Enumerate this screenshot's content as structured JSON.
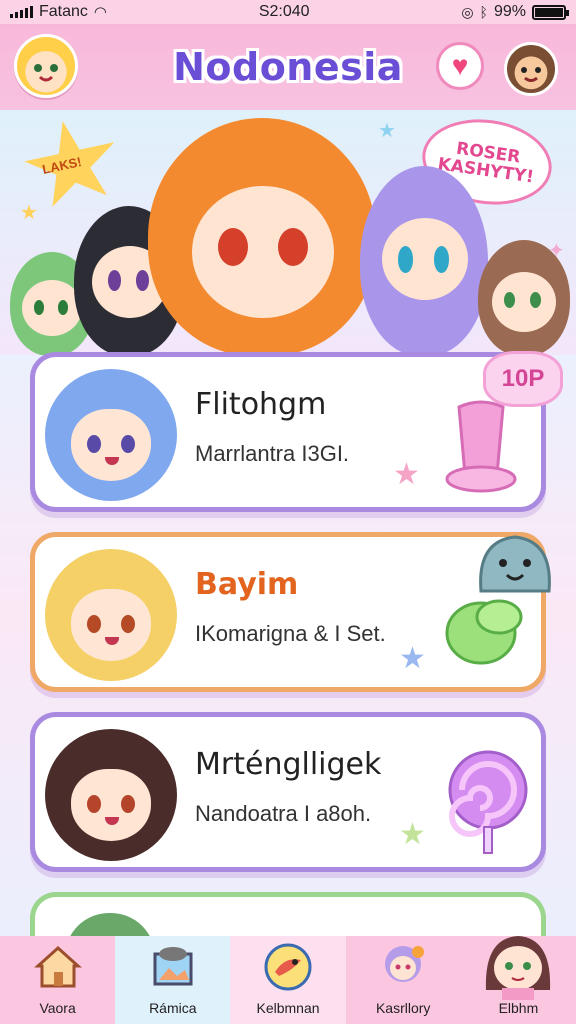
{
  "status_bar": {
    "carrier": "Fatanc",
    "time": "S2:040",
    "battery": "99%",
    "battery_level": 0.99
  },
  "header": {
    "title": "Nodonesia"
  },
  "hero": {
    "star_badge_text": "LAKS!",
    "bubble_text": "ROSER KASHYTY!"
  },
  "cards": [
    {
      "name": "Flitohgm",
      "subtitle": "Marrlantra I3GI.",
      "badge": "10P",
      "border_color": "#a98ae0"
    },
    {
      "name": "Bayim",
      "subtitle": "IKomarigna & I Set.",
      "border_color": "#f0a866"
    },
    {
      "name": "Mrténglligek",
      "subtitle": "Nandoatra I a8oh.",
      "border_color": "#a98ae0"
    }
  ],
  "bottom_nav": [
    {
      "label": "Vaora",
      "icon": "house-icon",
      "bg": "#fbc6e0"
    },
    {
      "label": "Rámica",
      "icon": "picture-frame-icon",
      "bg": "#dff1fb"
    },
    {
      "label": "Kelbmnan",
      "icon": "bird-badge-icon",
      "bg": "#fde0ef"
    },
    {
      "label": "Kasrllory",
      "icon": "character-icon",
      "bg": "#fbc6e0"
    },
    {
      "label": "Elbhm",
      "icon": "profile-character-icon",
      "bg": "#fbc6e0"
    }
  ]
}
